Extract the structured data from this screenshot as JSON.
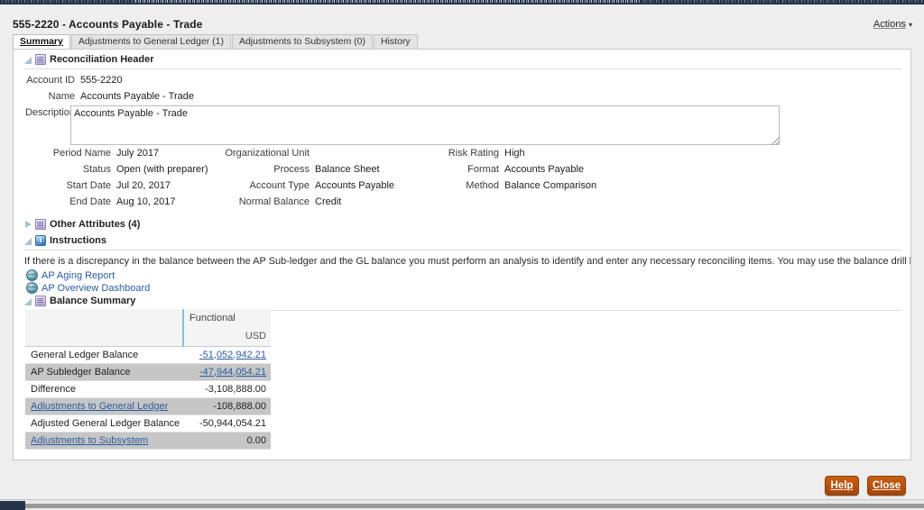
{
  "header": {
    "title": "555-2220 - Accounts Payable - Trade",
    "actions_label": "Actions",
    "actions_caret": "▾"
  },
  "tabs": [
    {
      "label": "Summary",
      "active": true
    },
    {
      "label": "Adjustments to General Ledger (1)",
      "active": false
    },
    {
      "label": "Adjustments to Subsystem (0)",
      "active": false
    },
    {
      "label": "History",
      "active": false
    }
  ],
  "sections": {
    "reconciliation_header": {
      "title": "Reconciliation Header",
      "icon": "document-icon",
      "expanded": true
    },
    "other_attributes": {
      "title": "Other Attributes (4)",
      "icon": "document-icon",
      "expanded": false
    },
    "instructions": {
      "title": "Instructions",
      "icon": "info-icon",
      "expanded": true
    },
    "balance_summary": {
      "title": "Balance Summary",
      "icon": "document-icon",
      "expanded": true
    }
  },
  "recon_header": {
    "account_id": {
      "label": "Account ID",
      "value": "555-2220"
    },
    "name": {
      "label": "Name",
      "value": "Accounts Payable - Trade"
    },
    "description": {
      "label": "Description",
      "value": "Accounts Payable - Trade"
    },
    "col1": [
      {
        "label": "Period Name",
        "value": "July 2017"
      },
      {
        "label": "Status",
        "value": "Open (with preparer)"
      },
      {
        "label": "Start Date",
        "value": "Jul 20, 2017"
      },
      {
        "label": "End Date",
        "value": "Aug 10, 2017"
      }
    ],
    "col2": [
      {
        "label": "Organizational Unit",
        "value": ""
      },
      {
        "label": "Process",
        "value": "Balance Sheet"
      },
      {
        "label": "Account Type",
        "value": "Accounts Payable"
      },
      {
        "label": "Normal Balance",
        "value": "Credit"
      }
    ],
    "col3": [
      {
        "label": "Risk Rating",
        "value": "High"
      },
      {
        "label": "Format",
        "value": "Accounts Payable"
      },
      {
        "label": "Method",
        "value": "Balance Comparison"
      }
    ]
  },
  "instructions": {
    "text": "If there is a discrepancy in the balance between the AP Sub-ledger and the GL balance you must perform an analysis to identify and enter any necessary reconciling items. You may use the balance drill back feature.",
    "links": [
      {
        "label": "AP Aging Report",
        "icon": "globe-icon"
      },
      {
        "label": "AP Overview Dashboard",
        "icon": "globe-icon"
      }
    ]
  },
  "balance_summary": {
    "col_header": "Functional",
    "currency": "USD",
    "rows": [
      {
        "label": "General Ledger Balance",
        "value": "-51,052,942.21",
        "label_link": false,
        "value_link": true,
        "shaded": false
      },
      {
        "label": "AP Subledger Balance",
        "value": "-47,944,054.21",
        "label_link": false,
        "value_link": true,
        "shaded": true
      },
      {
        "label": "Difference",
        "value": "-3,108,888.00",
        "label_link": false,
        "value_link": false,
        "shaded": false
      },
      {
        "label": "Adjustments to General Ledger",
        "value": "-108,888.00",
        "label_link": true,
        "value_link": false,
        "shaded": true
      },
      {
        "label": "Adjusted General Ledger Balance",
        "value": "-50,944,054.21",
        "label_link": false,
        "value_link": false,
        "shaded": false
      },
      {
        "label": "Adjustments to Subsystem",
        "value": "0.00",
        "label_link": true,
        "value_link": false,
        "shaded": true
      }
    ]
  },
  "footer": {
    "help_label": "Help",
    "close_label": "Close"
  },
  "colors": {
    "accent_orange": "#b4500d",
    "link_blue": "#2b5c9e",
    "table_shade": "#c6c6c6",
    "divider_blue": "#7fc4dd"
  }
}
